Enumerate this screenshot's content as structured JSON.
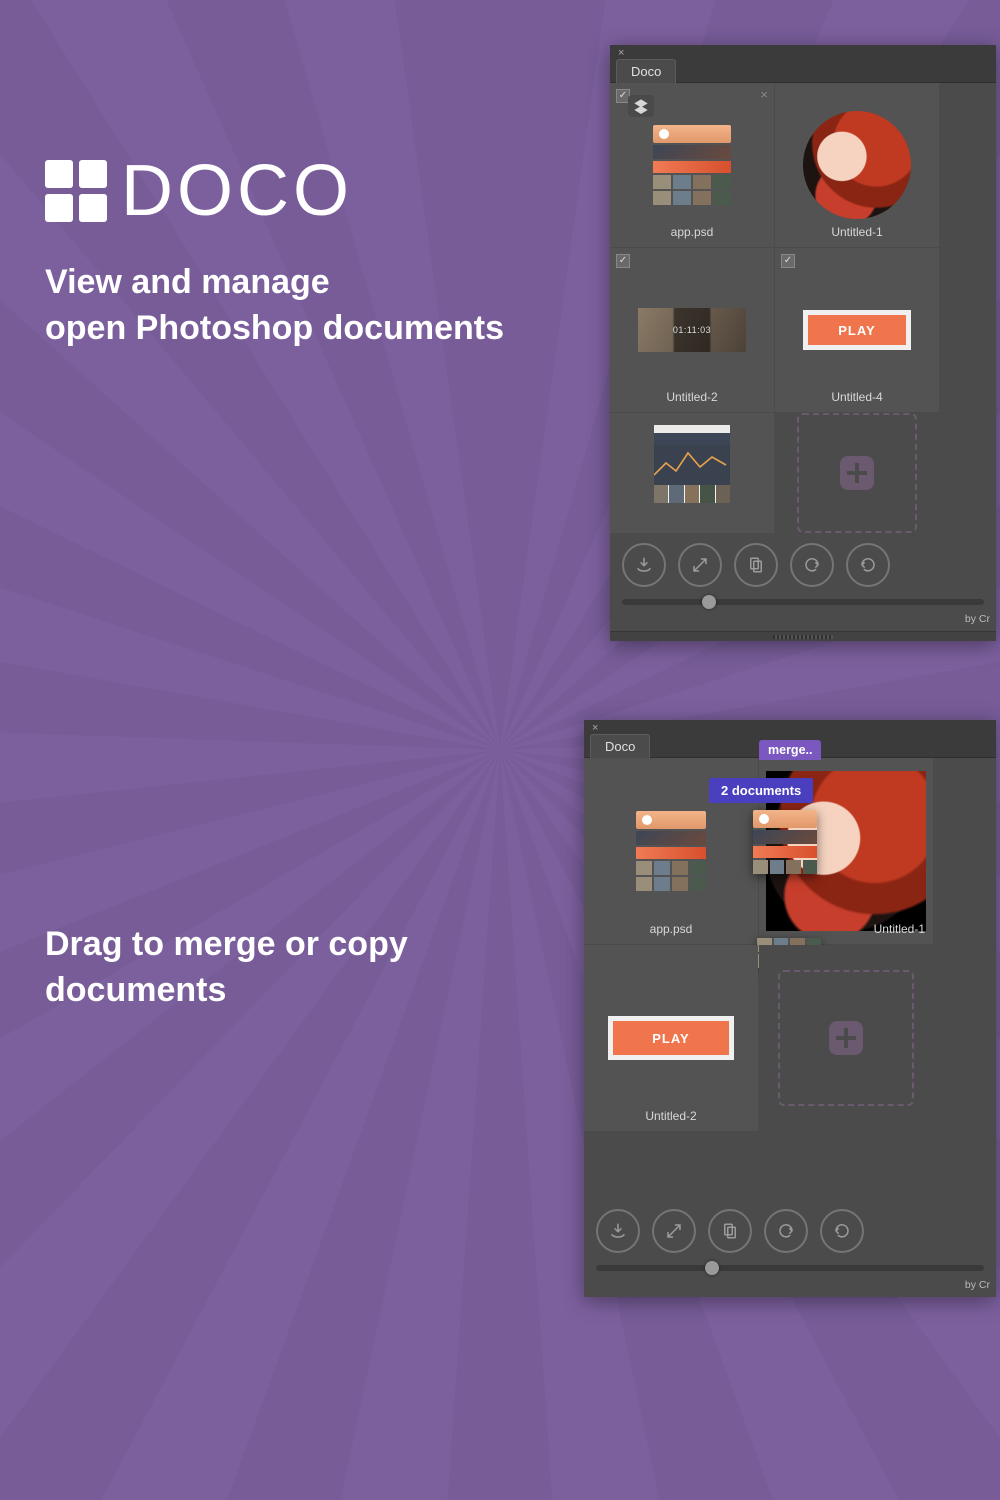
{
  "logo_word": "DOCO",
  "tagline1_a": "View and manage",
  "tagline1_b": "open Photoshop documents",
  "tagline2_a": "Drag to merge or copy",
  "tagline2_b": "documents",
  "panel_tab": "Doco",
  "close_x": "×",
  "chrome_x": "×",
  "credit_prefix": "by Cr",
  "wide_ts": "01:11:03",
  "play_label": "PLAY",
  "merge_label": "merge..",
  "doc_count": "2 documents",
  "p1": {
    "cells": [
      {
        "id": "app",
        "label": "app.psd",
        "checked": true,
        "close": true
      },
      {
        "id": "u1",
        "label": "Untitled-1",
        "checked": false,
        "close": true
      },
      {
        "id": "u2",
        "label": "Untitled-2",
        "checked": true,
        "close": false
      },
      {
        "id": "u4",
        "label": "Untitled-4",
        "checked": true,
        "close": false
      },
      {
        "id": "chart",
        "label": "",
        "checked": false,
        "close": false
      },
      {
        "id": "plus",
        "label": "",
        "checked": false,
        "close": false
      }
    ],
    "slider_pct": 22
  },
  "p2": {
    "cells": [
      {
        "id": "app",
        "label": "app.psd"
      },
      {
        "id": "u1",
        "label": "Untitled-1"
      },
      {
        "id": "u2",
        "label": "Untitled-2"
      },
      {
        "id": "plus",
        "label": ""
      }
    ],
    "drag_label": "app.psd",
    "slider_pct": 28
  },
  "toolbar_icons": [
    "merge",
    "expand",
    "copy",
    "undo",
    "redo"
  ]
}
